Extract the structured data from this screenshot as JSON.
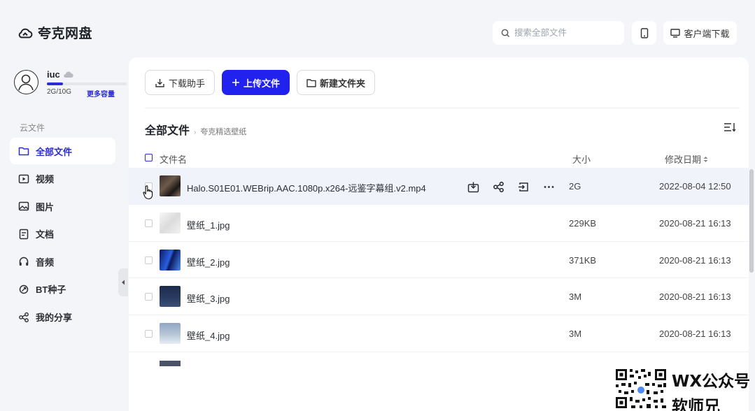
{
  "app": {
    "name": "夸克网盘"
  },
  "header": {
    "search_placeholder": "搜索全部文件",
    "client_download_label": "客户端下载"
  },
  "user": {
    "name": "iuc",
    "quota_text": "2G/10G",
    "quota_used_fraction": 0.2,
    "more_capacity_label": "更多容量"
  },
  "sidebar": {
    "section_label": "云文件",
    "items": [
      {
        "label": "全部文件",
        "icon": "folder-icon",
        "active": true
      },
      {
        "label": "视频",
        "icon": "video-icon"
      },
      {
        "label": "图片",
        "icon": "image-icon"
      },
      {
        "label": "文档",
        "icon": "document-icon"
      },
      {
        "label": "音频",
        "icon": "headphones-icon"
      },
      {
        "label": "BT种子",
        "icon": "bt-seed-icon"
      },
      {
        "label": "我的分享",
        "icon": "share-icon"
      }
    ]
  },
  "toolbar": {
    "download_helper_label": "下载助手",
    "upload_label": "上传文件",
    "new_folder_label": "新建文件夹"
  },
  "breadcrumb": {
    "root": "全部文件",
    "separator": "›",
    "current": "夸克精选壁纸"
  },
  "table": {
    "columns": {
      "name": "文件名",
      "size": "大小",
      "date": "修改日期"
    },
    "rows": [
      {
        "name": "Halo.S01E01.WEBrip.AAC.1080p.x264-远鉴字幕组.v2.mp4",
        "size": "2G",
        "date": "2022-08-04 12:50",
        "hover": true
      },
      {
        "name": "壁纸_1.jpg",
        "size": "229KB",
        "date": "2020-08-21 16:13"
      },
      {
        "name": "壁纸_2.jpg",
        "size": "371KB",
        "date": "2020-08-21 16:13"
      },
      {
        "name": "壁纸_3.jpg",
        "size": "3M",
        "date": "2020-08-21 16:13"
      },
      {
        "name": "壁纸_4.jpg",
        "size": "3M",
        "date": "2020-08-21 16:13"
      }
    ]
  },
  "watermark": {
    "line1": "WX公众号",
    "line2": "软师兄"
  },
  "colors": {
    "accent": "#2222ee",
    "background": "#f4f5f8"
  }
}
